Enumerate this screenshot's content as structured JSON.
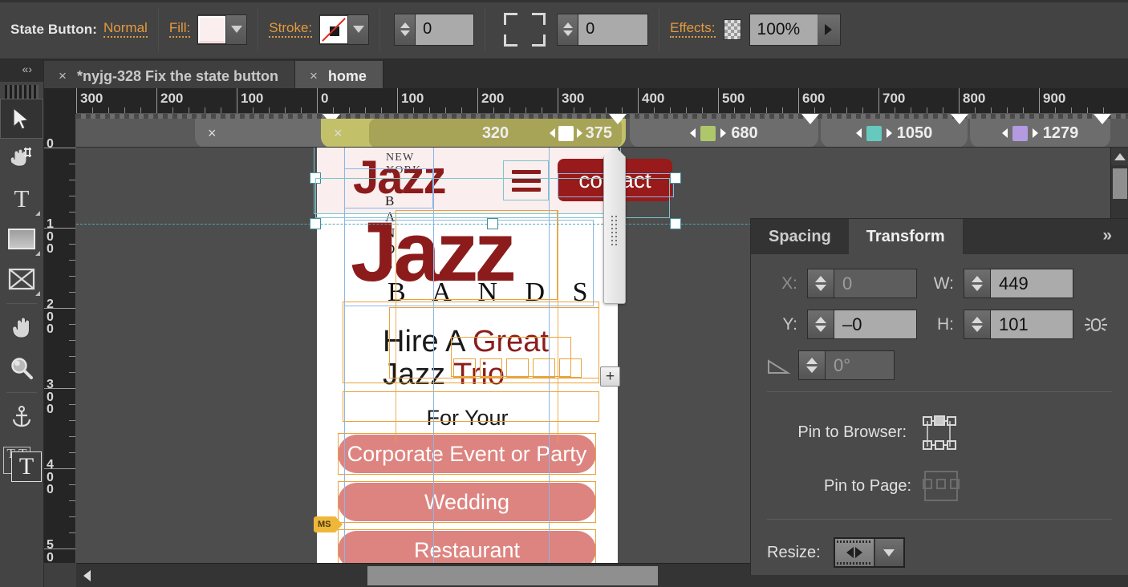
{
  "toolbar": {
    "state_button_label": "State Button:",
    "state_value": "Normal",
    "fill_label": "Fill:",
    "fill_color": "#fbeeee",
    "stroke_label": "Stroke:",
    "stroke_value": "none",
    "stroke_width": "0",
    "corner_radius": "0",
    "effects_label": "Effects:",
    "opacity": "100%"
  },
  "tabs": [
    {
      "label": "*nyjg-328 Fix the state button",
      "close": "×",
      "active": false
    },
    {
      "label": "home",
      "close": "×",
      "active": true
    }
  ],
  "tools": [
    {
      "name": "selection-tool",
      "glyph": "➤"
    },
    {
      "name": "crop-tool",
      "glyph": "⨉"
    },
    {
      "name": "text-tool",
      "glyph": "T"
    },
    {
      "name": "rectangle-tool",
      "glyph": "▭"
    },
    {
      "name": "image-frame-tool",
      "glyph": "☒"
    },
    {
      "name": "hand-tool",
      "glyph": "✋"
    },
    {
      "name": "zoom-tool",
      "glyph": "⚲"
    },
    {
      "name": "anchor-tool",
      "glyph": "⚓"
    },
    {
      "name": "type-tool",
      "glyph": "T"
    }
  ],
  "rulers": {
    "horizontal": [
      "300",
      "200",
      "100",
      "0",
      "100",
      "200",
      "300",
      "400",
      "500",
      "600",
      "700",
      "800",
      "900"
    ],
    "vertical": [
      "0",
      "100",
      "200",
      "300",
      "400",
      "500"
    ]
  },
  "breakpoints": [
    {
      "label": "",
      "value": "",
      "color": "#6d6d6d",
      "close": "×",
      "active": false
    },
    {
      "label": "320",
      "value": "375",
      "color": "#c3c06a",
      "close": "×",
      "active": true
    },
    {
      "label": "",
      "value": "680",
      "color": "#aec76a",
      "close": "",
      "active": false
    },
    {
      "label": "",
      "value": "1050",
      "color": "#66c9bd",
      "close": "",
      "active": false
    },
    {
      "label": "",
      "value": "1279",
      "color": "#b49ae0",
      "close": "",
      "active": false
    }
  ],
  "canvas": {
    "brand_top": "NEW YORK",
    "brand_main": "Jazz",
    "brand_sub": "B A N D S",
    "contact_button": "contact",
    "hero_title": "Jazz",
    "hero_sub": "B A N D S",
    "headline_1": "Hire A ",
    "headline_1_accent": "Great",
    "headline_2": "Jazz ",
    "headline_2_accent": "Trio",
    "for_your": "For Your",
    "buttons": [
      "Corporate Event or Party",
      "Wedding",
      "Restaurant"
    ],
    "ms_tag": "MS",
    "add_button": "+",
    "colors": {
      "brand_red": "#8c1c1c",
      "contact_red": "#981a1a",
      "pill_pink": "#dd8480",
      "header_bg": "#fbeeee"
    }
  },
  "panel": {
    "tab_spacing": "Spacing",
    "tab_transform": "Transform",
    "expand": "»",
    "x_label": "X:",
    "x_value": "0",
    "y_label": "Y:",
    "y_value": "–0",
    "w_label": "W:",
    "w_value": "449",
    "h_label": "H:",
    "h_value": "101",
    "angle_value": "0°",
    "pin_browser_label": "Pin to Browser:",
    "pin_page_label": "Pin to Page:",
    "resize_label": "Resize:"
  }
}
